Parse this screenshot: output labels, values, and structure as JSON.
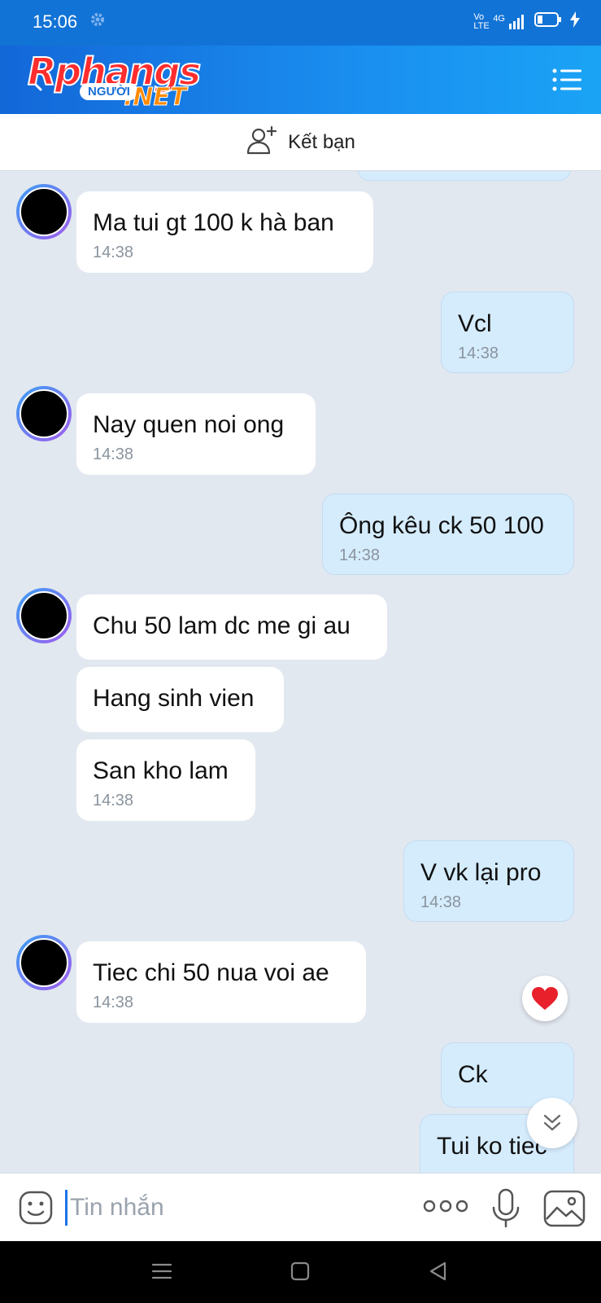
{
  "status_bar": {
    "time": "15:06",
    "network": "4G",
    "volte": "Vo LTE"
  },
  "header": {
    "logo_main": "Rphangs",
    "logo_pill": "NGƯỜI",
    "logo_net": ".NET"
  },
  "friend_bar": {
    "label": "Kết bạn",
    "icon": "add-friend-icon"
  },
  "messages": [
    {
      "side": "in",
      "text": "Ma tui gt 100 k hà ban",
      "time": "14:38"
    },
    {
      "side": "out",
      "text": "Vcl",
      "time": "14:38"
    },
    {
      "side": "in",
      "text": "Nay quen noi ong",
      "time": "14:38"
    },
    {
      "side": "out",
      "text": "Ông kêu ck 50 100",
      "time": "14:38"
    },
    {
      "side": "in",
      "text": "Chu 50 lam dc me gi au",
      "time": ""
    },
    {
      "side": "in",
      "text": "Hang sinh vien",
      "time": ""
    },
    {
      "side": "in",
      "text": "San kho lam",
      "time": "14:38"
    },
    {
      "side": "out",
      "text": "V vk lại pro",
      "time": "14:38"
    },
    {
      "side": "in",
      "text": "Tiec chi 50 nua voi ae",
      "time": "14:38",
      "reaction": "heart"
    },
    {
      "side": "out",
      "text": "Ck",
      "time": ""
    },
    {
      "side": "out",
      "text": "Tui ko tiec",
      "time": ""
    }
  ],
  "input": {
    "placeholder": "Tin nhắn",
    "value": ""
  },
  "colors": {
    "header_start": "#1367d8",
    "header_end": "#1aa3f5",
    "bubble_out": "#d5ecfd",
    "bubble_in": "#ffffff",
    "chat_bg": "#e2e8f0"
  }
}
